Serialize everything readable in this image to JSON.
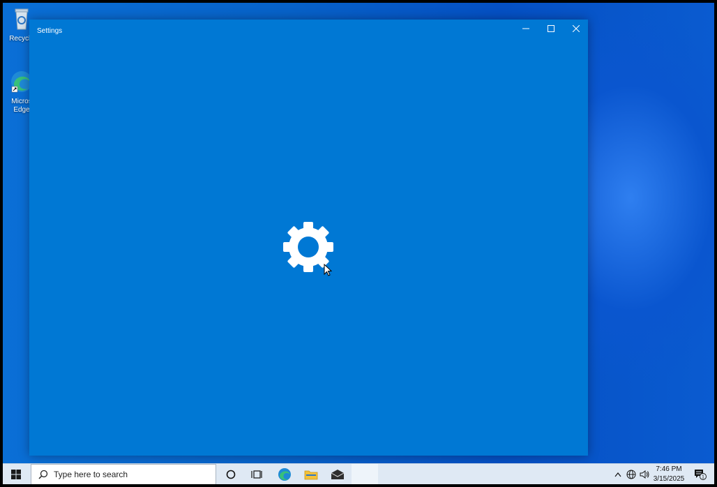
{
  "desktop": {
    "icons": [
      {
        "label": "Recycle"
      },
      {
        "label": "Micros\nEdge"
      }
    ]
  },
  "window": {
    "title": "Settings",
    "accent": "#0078d4"
  },
  "taskbar": {
    "search_placeholder": "Type here to search",
    "clock": {
      "time": "7:46 PM",
      "date": "3/15/2025"
    },
    "notification_count": "1"
  }
}
